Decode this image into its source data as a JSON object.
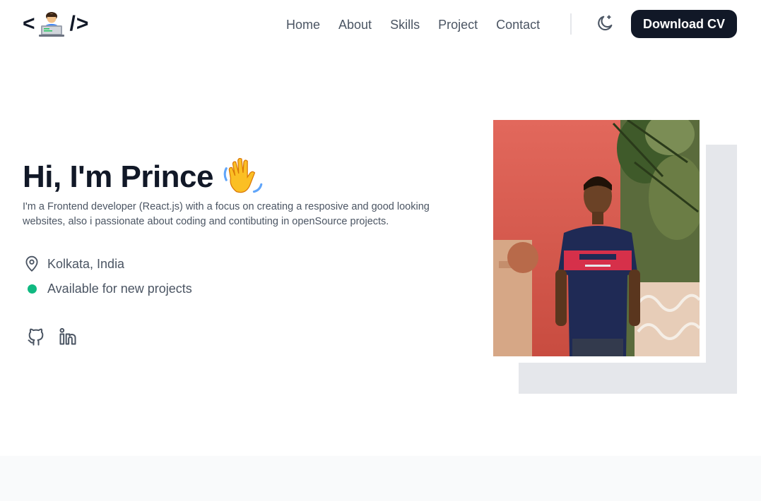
{
  "logo": {
    "open": "<",
    "close": "/>",
    "icon": "technologist-emoji"
  },
  "nav": {
    "links": [
      "Home",
      "About",
      "Skills",
      "Project",
      "Contact"
    ],
    "theme_icon": "moon-sparkle-icon",
    "cv_label": "Download CV"
  },
  "hero": {
    "title": "Hi, I'm Prince",
    "wave_icon": "waving-hand-emoji",
    "description": "I'm a Frontend developer (React.js) with a focus on creating a resposive and good looking websites, also i passionate about coding and contibuting in openSource projects.",
    "location": "Kolkata, India",
    "availability": "Available for new projects",
    "socials": [
      "github-icon",
      "linkedin-icon"
    ]
  },
  "colors": {
    "primary": "#111827",
    "text_muted": "#4b5563",
    "status_green": "#10b981",
    "photo_shadow": "#e5e7eb"
  }
}
